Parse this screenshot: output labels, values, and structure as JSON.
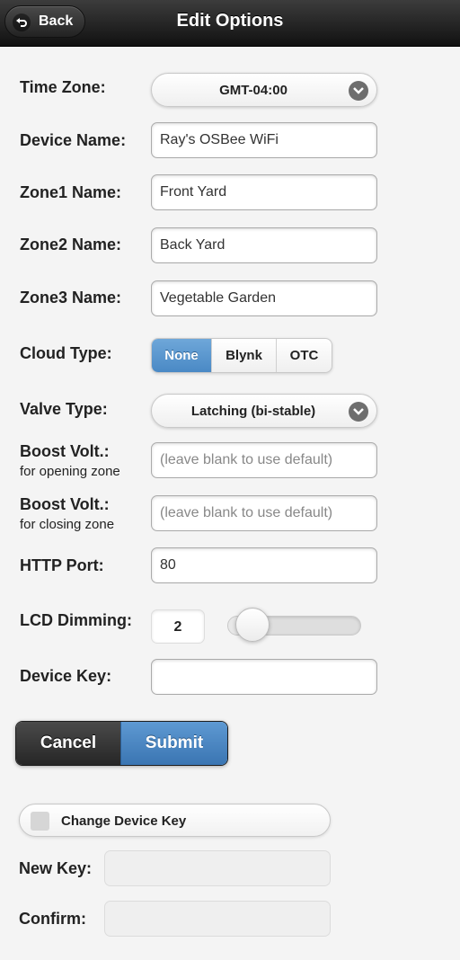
{
  "header": {
    "back_label": "Back",
    "title": "Edit Options"
  },
  "form": {
    "time_zone": {
      "label": "Time Zone:",
      "value": "GMT-04:00"
    },
    "device_name": {
      "label": "Device Name:",
      "value": "Ray's OSBee WiFi"
    },
    "zone1": {
      "label": "Zone1 Name:",
      "value": "Front Yard"
    },
    "zone2": {
      "label": "Zone2 Name:",
      "value": "Back Yard"
    },
    "zone3": {
      "label": "Zone3 Name:",
      "value": "Vegetable Garden"
    },
    "cloud_type": {
      "label": "Cloud Type:",
      "options": [
        "None",
        "Blynk",
        "OTC"
      ],
      "selected": "None"
    },
    "valve_type": {
      "label": "Valve Type:",
      "value": "Latching (bi-stable)"
    },
    "boost_open": {
      "label": "Boost Volt.:",
      "sublabel": "for opening zone",
      "placeholder": "(leave blank to use default)"
    },
    "boost_close": {
      "label": "Boost Volt.:",
      "sublabel": "for closing zone",
      "placeholder": "(leave blank to use default)"
    },
    "http_port": {
      "label": "HTTP Port:",
      "value": "80"
    },
    "lcd_dimming": {
      "label": "LCD Dimming:",
      "value": "2",
      "fraction": 0.13
    },
    "device_key": {
      "label": "Device Key:",
      "value": ""
    }
  },
  "actions": {
    "cancel_label": "Cancel",
    "submit_label": "Submit"
  },
  "change_key": {
    "checkbox_label": "Change Device Key",
    "checked": false,
    "new_key_label": "New Key:",
    "confirm_label": "Confirm:"
  },
  "colors": {
    "accent": "#4a89c5",
    "header": "#1a1a1a"
  }
}
